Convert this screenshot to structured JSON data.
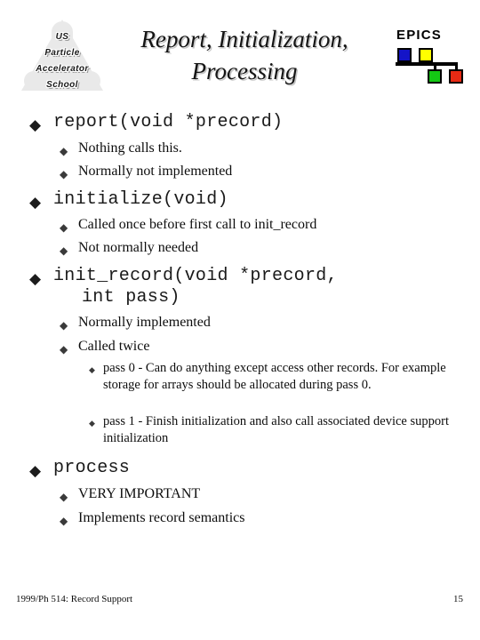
{
  "slide": {
    "title": "Report, Initialization, Processing",
    "title_line1": "Report, Initialization,",
    "title_line2": "Processing",
    "bullet_glyph": "◆"
  },
  "logo": {
    "line1": "US",
    "line2": "Particle",
    "line3": "Accelerator",
    "line4": "School",
    "full_name": "US Particle Accelerator School"
  },
  "epics": {
    "wordmark": "EPICS",
    "colors": {
      "blue": "#1414c8",
      "yellow": "#ffff00",
      "green": "#14c814",
      "red": "#e82a14",
      "outline": "#000000"
    }
  },
  "content": {
    "items": [
      {
        "level": 1,
        "text": "report(void *precord)"
      },
      {
        "level": 2,
        "text": "Nothing calls this."
      },
      {
        "level": 2,
        "text": "Normally not implemented"
      },
      {
        "level": 1,
        "text": "initialize(void)"
      },
      {
        "level": 2,
        "text": "Called once before first call to init_record"
      },
      {
        "level": 2,
        "text": "Not normally needed"
      },
      {
        "level": 1,
        "text": "init_record(void *precord,",
        "continuation": "int pass)"
      },
      {
        "level": 2,
        "text": "Normally implemented"
      },
      {
        "level": 2,
        "text": "Called twice"
      },
      {
        "level": 3,
        "text": "pass 0 - Can do anything except access other records. For example storage for arrays should be allocated during pass 0."
      },
      {
        "level": 3,
        "text": "pass 1 - Finish initialization and also call associated device support initialization"
      },
      {
        "level": 1,
        "text": "process"
      },
      {
        "level": 2,
        "text": "VERY IMPORTANT"
      },
      {
        "level": 2,
        "text": "Implements record semantics"
      }
    ]
  },
  "footer": {
    "left": "1999/Ph 514: Record Support",
    "page_number": "15"
  }
}
